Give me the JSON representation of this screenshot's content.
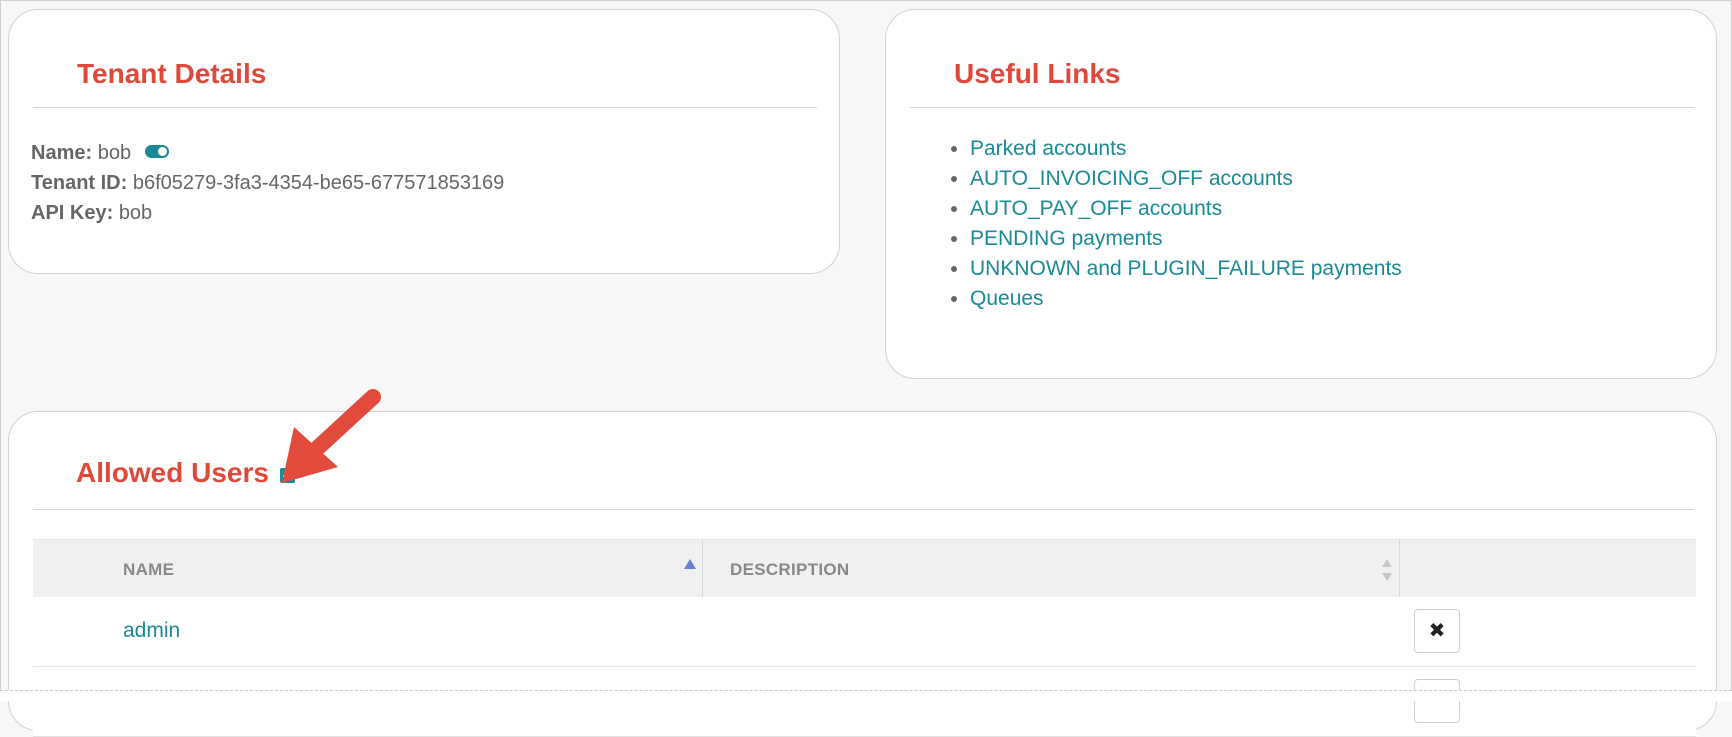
{
  "tenant_details": {
    "title": "Tenant Details",
    "name_label": "Name:",
    "name_value": "bob",
    "tenant_id_label": "Tenant ID:",
    "tenant_id_value": "b6f05279-3fa3-4354-be65-677571853169",
    "api_key_label": "API Key:",
    "api_key_value": "bob"
  },
  "useful_links": {
    "title": "Useful Links",
    "items": [
      "Parked accounts",
      "AUTO_INVOICING_OFF accounts",
      "AUTO_PAY_OFF accounts",
      "PENDING payments",
      "UNKNOWN and PLUGIN_FAILURE payments",
      "Queues"
    ]
  },
  "allowed_users": {
    "title": "Allowed Users",
    "columns": [
      "NAME",
      "DESCRIPTION"
    ],
    "rows": [
      {
        "name": "admin",
        "description": "",
        "action": "✖"
      }
    ]
  },
  "colors": {
    "accent": "#1a8a96",
    "title": "#e0483a",
    "arrow": "#e24b3c"
  }
}
